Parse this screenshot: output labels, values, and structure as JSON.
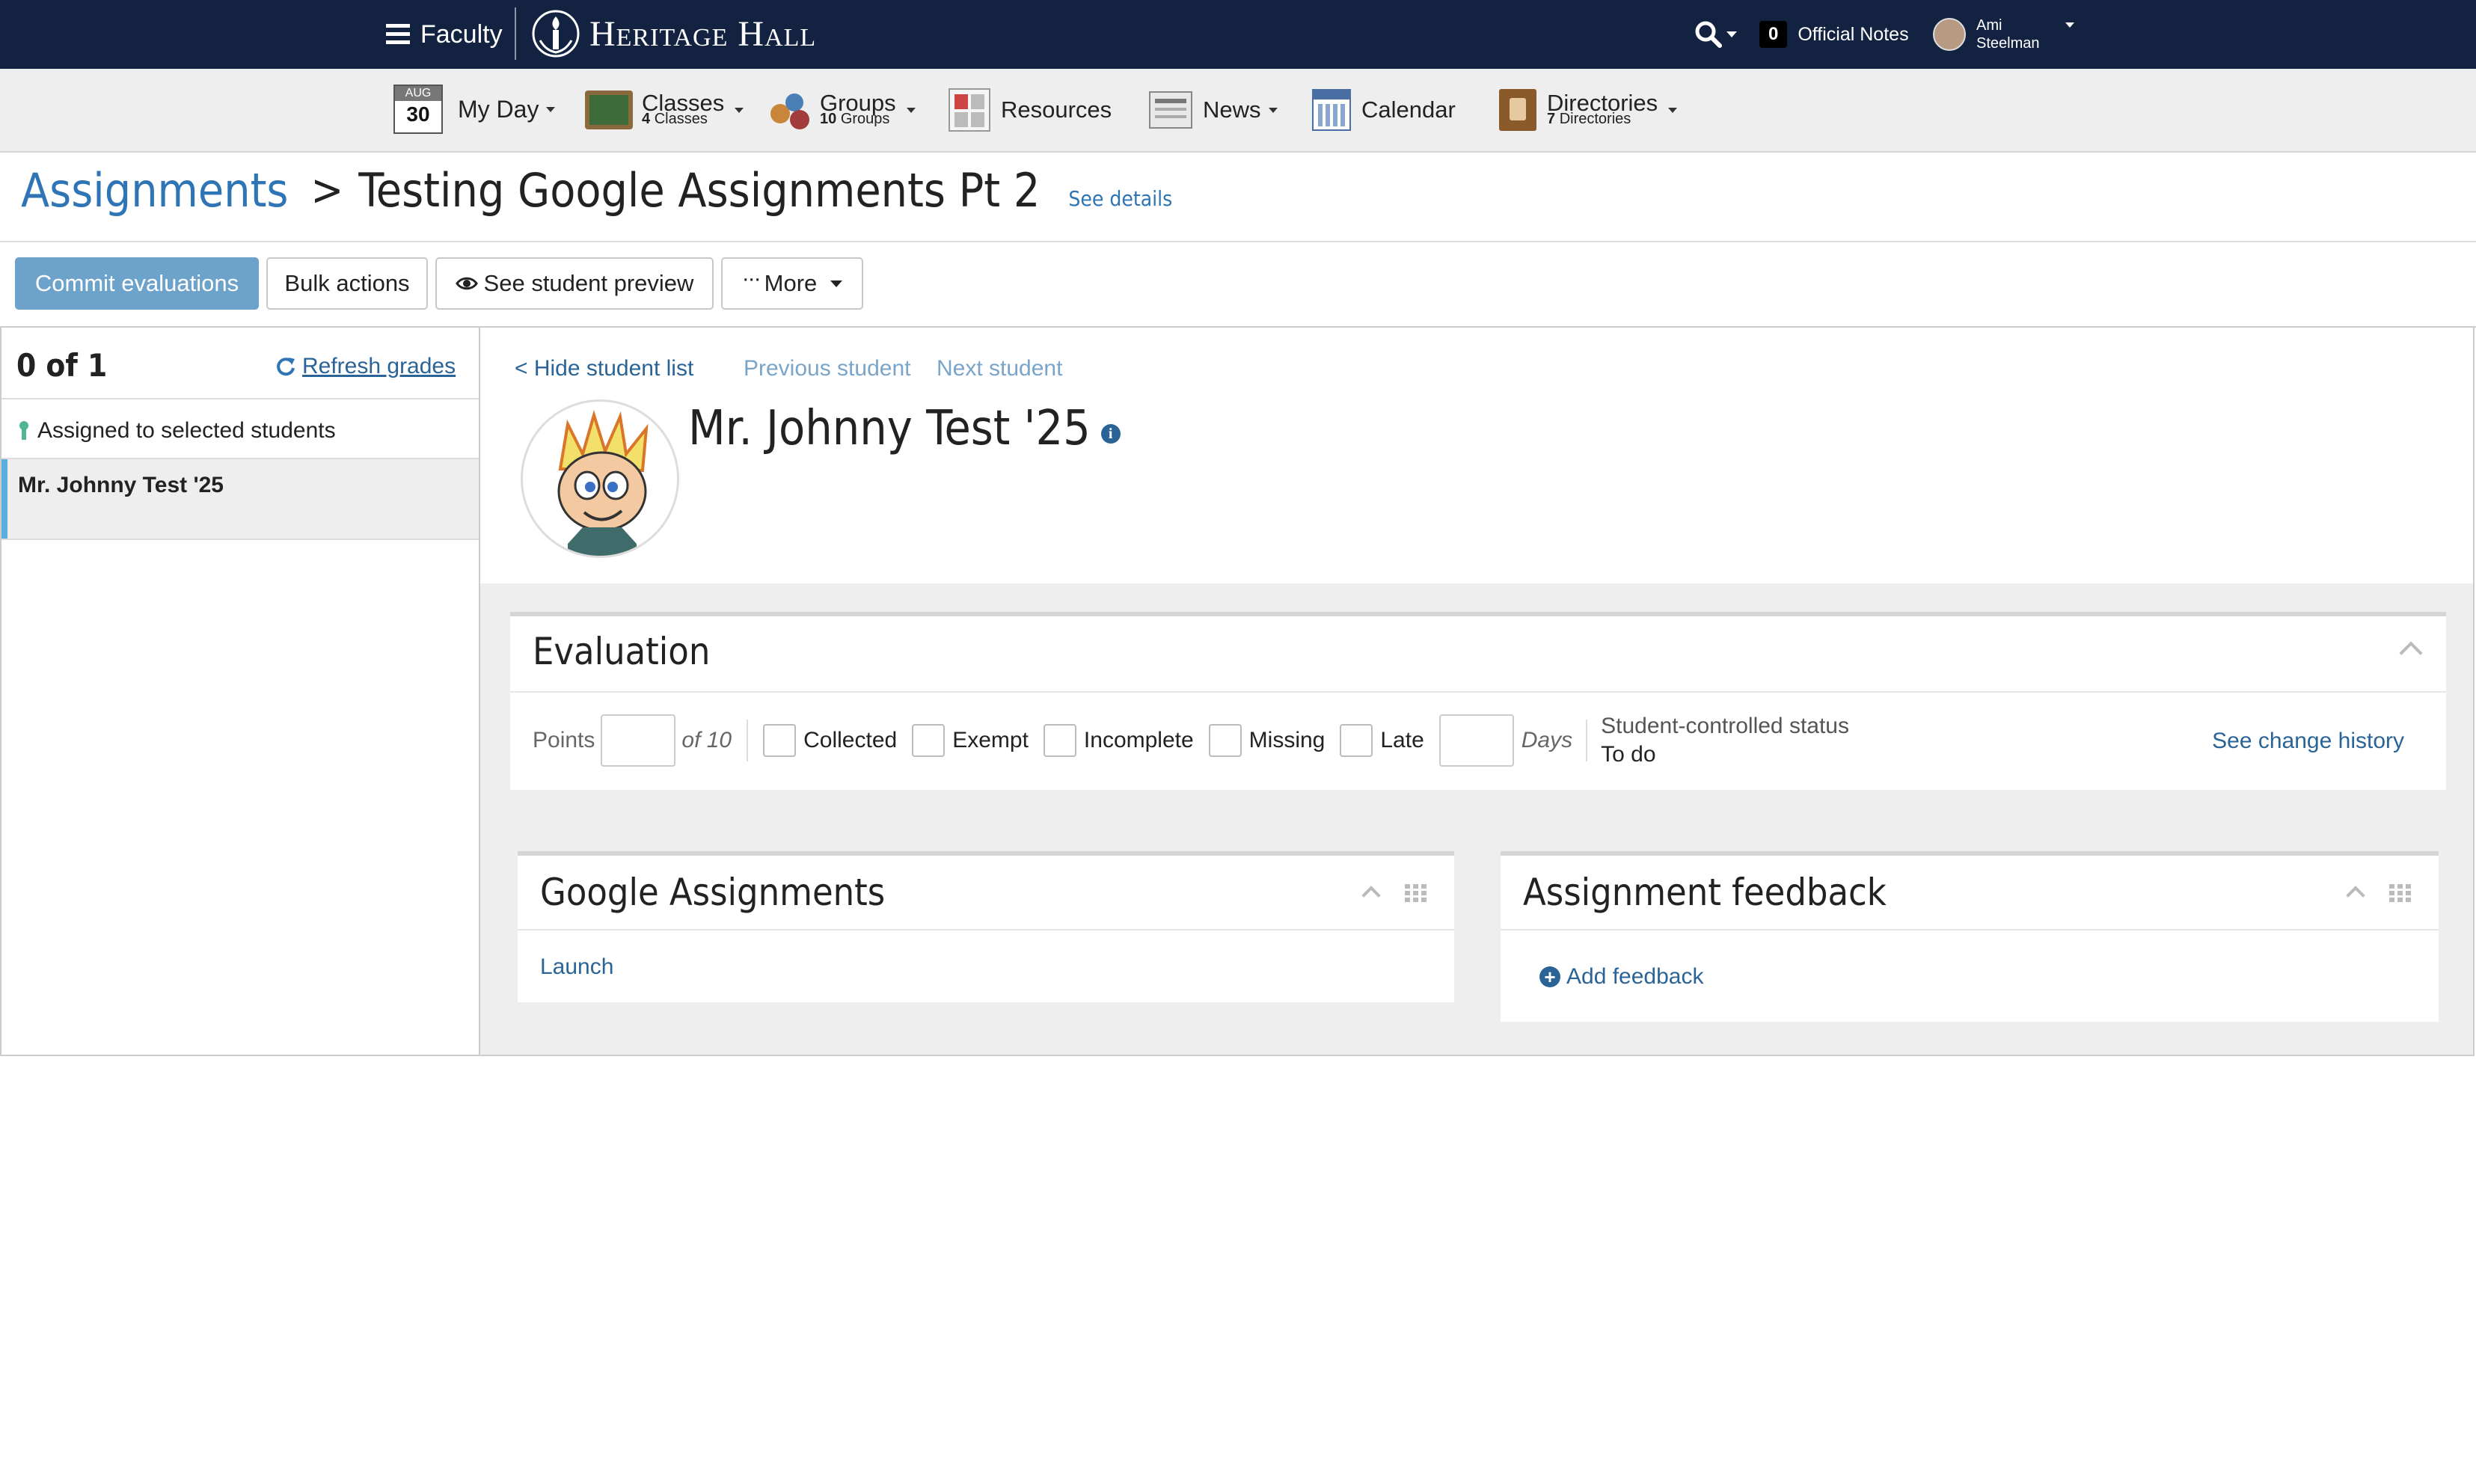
{
  "header": {
    "menu_label": "Faculty",
    "logo_text": "Heritage Hall",
    "notes_count": "0",
    "notes_label": "Official Notes",
    "user_first": "Ami",
    "user_last": "Steelman"
  },
  "nav": {
    "myday_month": "AUG",
    "myday_day": "30",
    "myday_label": "My Day",
    "classes_label": "Classes",
    "classes_count": "4",
    "classes_unit": "Classes",
    "groups_label": "Groups",
    "groups_count": "10",
    "groups_unit": "Groups",
    "resources_label": "Resources",
    "news_label": "News",
    "calendar_label": "Calendar",
    "directories_label": "Directories",
    "directories_count": "7",
    "directories_unit": "Directories"
  },
  "breadcrumb": {
    "root": "Assignments",
    "separator": ">",
    "title": "Testing Google Assignments Pt 2",
    "details_link": "See details"
  },
  "toolbar": {
    "commit_label": "Commit evaluations",
    "bulk_label": "Bulk actions",
    "preview_label": "See student preview",
    "more_label": "More"
  },
  "sidebar": {
    "count_label": "0 of 1",
    "refresh_label": "Refresh grades",
    "group_label": "Assigned to selected students",
    "students": [
      "Mr. Johnny Test '25"
    ]
  },
  "student": {
    "hide_list": "< Hide student list",
    "previous": "Previous student",
    "next": "Next student",
    "name": "Mr. Johnny Test '25"
  },
  "evaluation": {
    "title": "Evaluation",
    "points_label": "Points",
    "points_value": "",
    "points_max": "of 10",
    "collected": "Collected",
    "exempt": "Exempt",
    "incomplete": "Incomplete",
    "missing": "Missing",
    "late": "Late",
    "days_value": "",
    "days_label": "Days",
    "status_label": "Student-controlled status",
    "status_value": "To do",
    "history_link": "See change history"
  },
  "google": {
    "title": "Google Assignments",
    "launch": "Launch"
  },
  "feedback": {
    "title": "Assignment feedback",
    "add": "Add feedback"
  },
  "colors": {
    "topbar": "#122240",
    "accent": "#2a6496",
    "commit_button": "#6da2cb",
    "selected_indicator": "#5aaee0"
  }
}
